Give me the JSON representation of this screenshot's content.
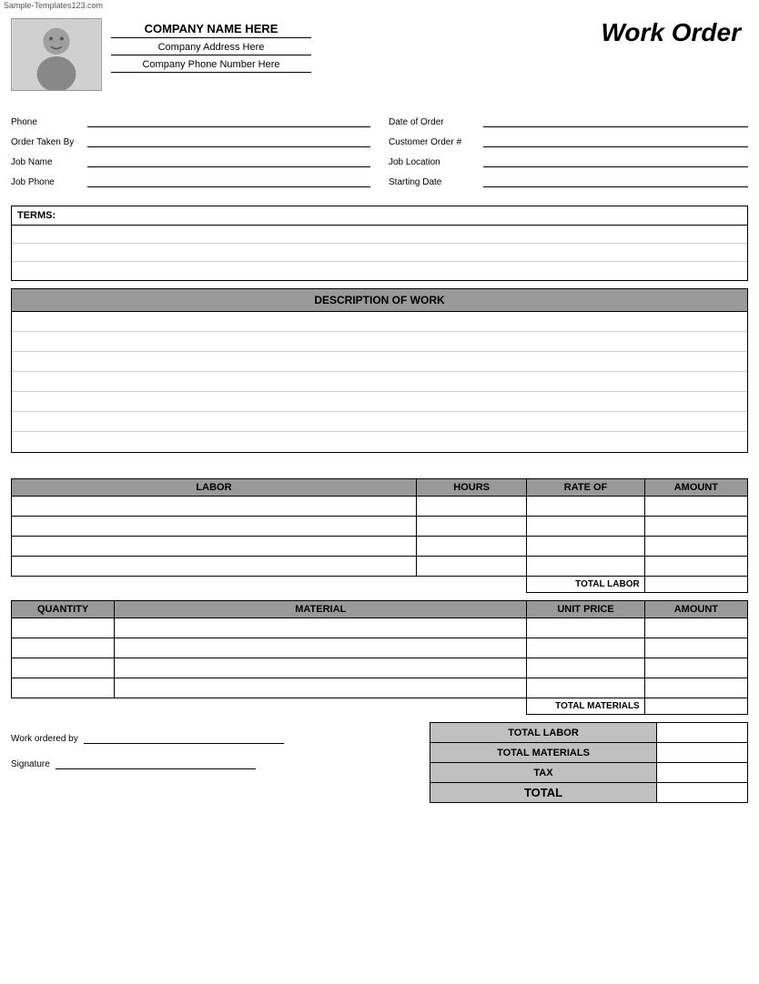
{
  "watermark": {
    "text": "Sample-Templates123.com"
  },
  "header": {
    "company_name": "COMPANY NAME HERE",
    "company_address": "Company Address Here",
    "company_phone": "Company Phone Number Here",
    "title": "Work Order"
  },
  "fields": {
    "left": [
      {
        "label": "Phone",
        "value": ""
      },
      {
        "label": "Order Taken By",
        "value": ""
      },
      {
        "label": "Job Name",
        "value": ""
      },
      {
        "label": "Job Phone",
        "value": ""
      }
    ],
    "right": [
      {
        "label": "Date of Order",
        "value": ""
      },
      {
        "label": "Customer Order #",
        "value": ""
      },
      {
        "label": "Job Location",
        "value": ""
      },
      {
        "label": "Starting Date",
        "value": ""
      }
    ]
  },
  "terms": {
    "label": "TERMS:",
    "rows": 3
  },
  "description": {
    "header": "DESCRIPTION OF WORK",
    "rows": 7
  },
  "labor_table": {
    "headers": [
      "LABOR",
      "HOURS",
      "RATE OF",
      "AMOUNT"
    ],
    "col_widths": [
      "55%",
      "15%",
      "16%",
      "14%"
    ],
    "rows": 4,
    "total_label": "TOTAL LABOR"
  },
  "materials_table": {
    "headers": [
      "QUANTITY",
      "MATERIAL",
      "UNIT PRICE",
      "AMOUNT"
    ],
    "col_widths": [
      "15%",
      "55%",
      "16%",
      "14%"
    ],
    "rows": 4,
    "total_label": "TOTAL MATERIALS"
  },
  "subtotals": [
    {
      "label": "TOTAL LABOR",
      "value": ""
    },
    {
      "label": "TOTAL MATERIALS",
      "value": ""
    },
    {
      "label": "TAX",
      "value": ""
    },
    {
      "label": "TOTAL",
      "value": ""
    }
  ],
  "signature": {
    "work_ordered_by_label": "Work ordered by",
    "signature_label": "Signature"
  }
}
